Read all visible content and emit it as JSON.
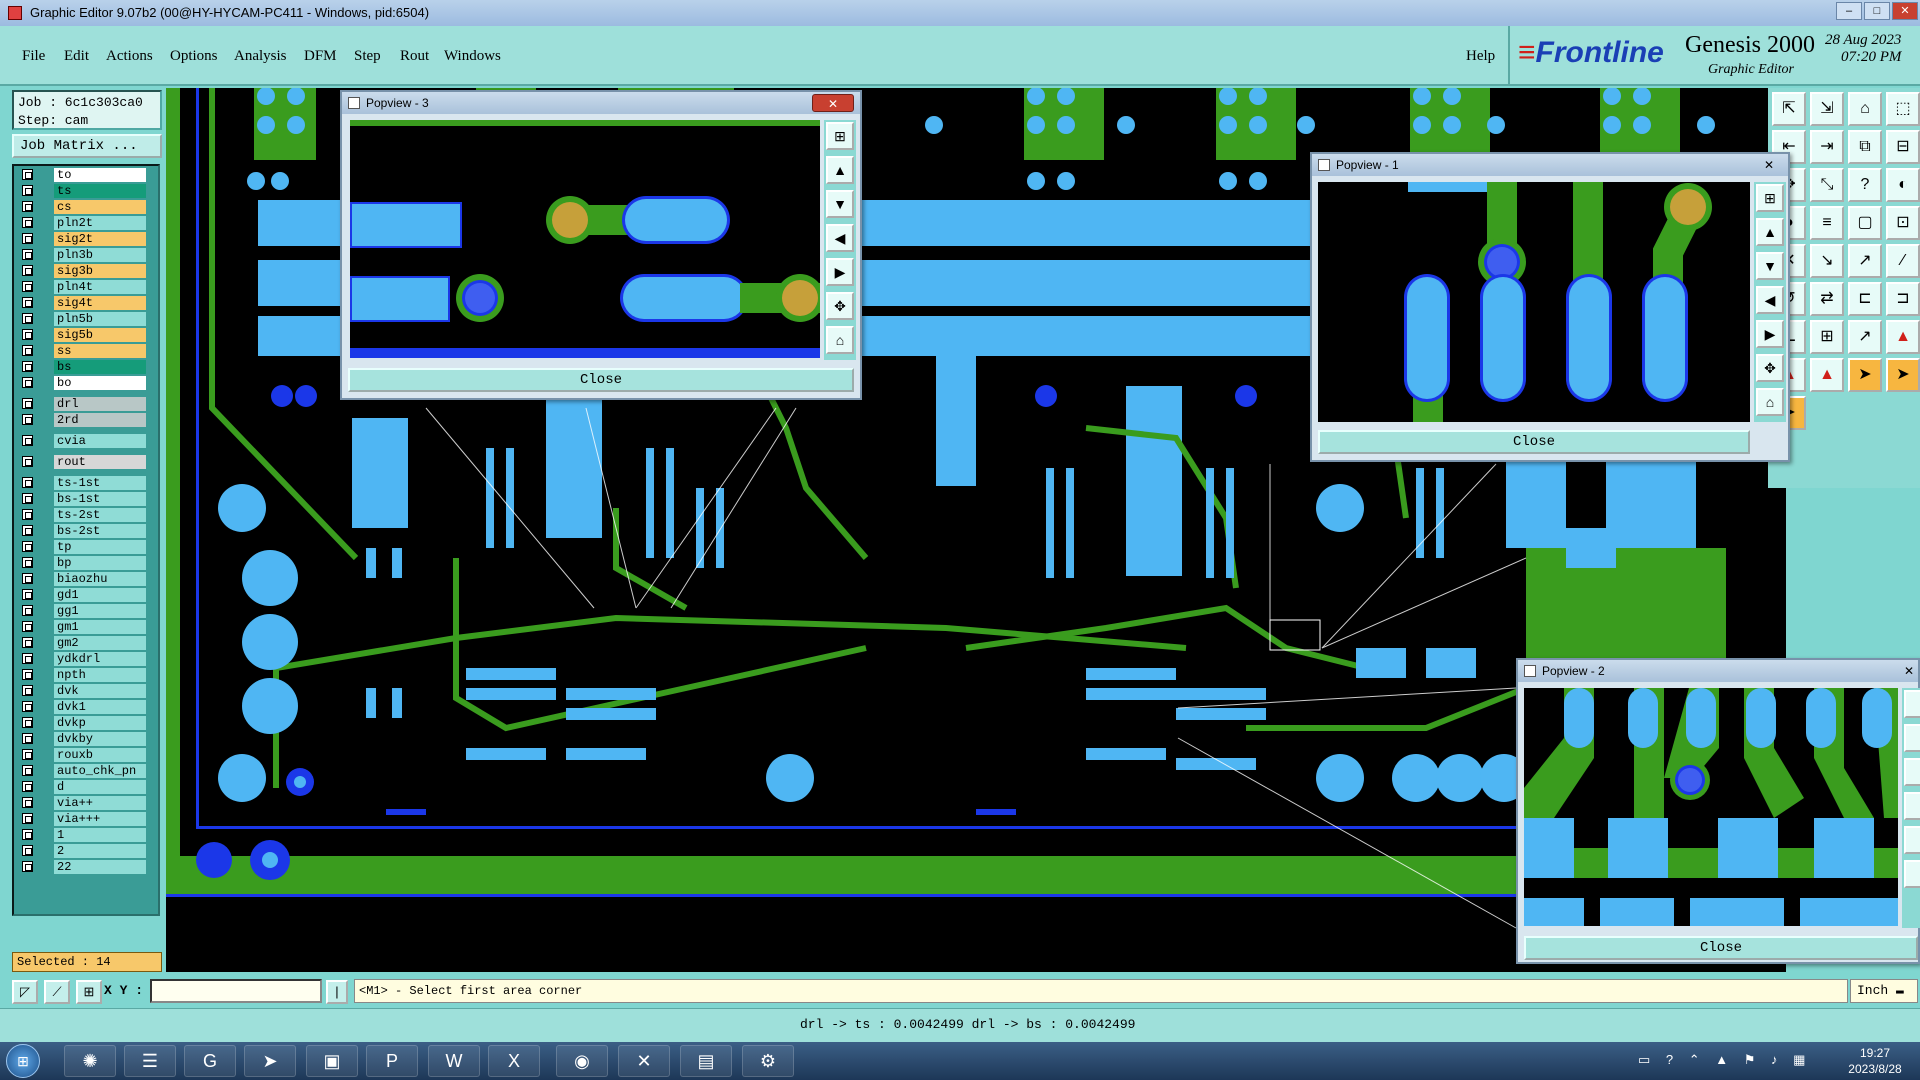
{
  "window": {
    "title": "Graphic Editor 9.07b2 (00@HY-HYCAM-PC411 - Windows, pid:6504)",
    "min": "–",
    "max": "□",
    "close": "✕"
  },
  "menu": {
    "items": [
      "File",
      "Edit",
      "Actions",
      "Options",
      "Analysis",
      "DFM",
      "Step",
      "Rout",
      "Windows"
    ],
    "help": "Help"
  },
  "brand": {
    "logo": "Frontline",
    "product": "Genesis 2000",
    "subtitle": "Graphic Editor",
    "date": "28 Aug 2023",
    "time": "07:20 PM"
  },
  "job": {
    "job_line": "Job : 6c1c303ca0",
    "step_line": "Step: cam",
    "matrix_button": "Job Matrix ..."
  },
  "layers": [
    {
      "name": "to",
      "color": "#ffffff"
    },
    {
      "name": "ts",
      "color": "#159c7a"
    },
    {
      "name": "cs",
      "color": "#f7c86a"
    },
    {
      "name": "pln2t",
      "color": "#8fdcd6"
    },
    {
      "name": "sig2t",
      "color": "#f7c86a"
    },
    {
      "name": "pln3b",
      "color": "#8fdcd6"
    },
    {
      "name": "sig3b",
      "color": "#f7c86a"
    },
    {
      "name": "pln4t",
      "color": "#8fdcd6"
    },
    {
      "name": "sig4t",
      "color": "#f7c86a"
    },
    {
      "name": "pln5b",
      "color": "#8fdcd6"
    },
    {
      "name": "sig5b",
      "color": "#f7c86a"
    },
    {
      "name": "ss",
      "color": "#f7c86a"
    },
    {
      "name": "bs",
      "color": "#159c7a"
    },
    {
      "name": "bo",
      "color": "#ffffff"
    },
    {
      "name": "drl",
      "color": "#b8c7c6"
    },
    {
      "name": "2rd",
      "color": "#b8c7c6"
    },
    {
      "name": "cvia",
      "color": "#8fdcd6"
    },
    {
      "name": "rout",
      "color": "#d7d7d7"
    },
    {
      "name": "ts-1st",
      "color": "#8fdcd6"
    },
    {
      "name": "bs-1st",
      "color": "#8fdcd6"
    },
    {
      "name": "ts-2st",
      "color": "#8fdcd6"
    },
    {
      "name": "bs-2st",
      "color": "#8fdcd6"
    },
    {
      "name": "tp",
      "color": "#8fdcd6"
    },
    {
      "name": "bp",
      "color": "#8fdcd6"
    },
    {
      "name": "biaozhu",
      "color": "#8fdcd6"
    },
    {
      "name": "gd1",
      "color": "#8fdcd6"
    },
    {
      "name": "gg1",
      "color": "#8fdcd6"
    },
    {
      "name": "gm1",
      "color": "#8fdcd6"
    },
    {
      "name": "gm2",
      "color": "#8fdcd6"
    },
    {
      "name": "ydkdrl",
      "color": "#8fdcd6"
    },
    {
      "name": "npth",
      "color": "#8fdcd6"
    },
    {
      "name": "dvk",
      "color": "#8fdcd6"
    },
    {
      "name": "dvk1",
      "color": "#8fdcd6"
    },
    {
      "name": "dvkp",
      "color": "#8fdcd6"
    },
    {
      "name": "dvkby",
      "color": "#8fdcd6"
    },
    {
      "name": "rouxb",
      "color": "#8fdcd6"
    },
    {
      "name": "auto_chk_pn",
      "color": "#8fdcd6"
    },
    {
      "name": "d",
      "color": "#8fdcd6"
    },
    {
      "name": "via++",
      "color": "#8fdcd6"
    },
    {
      "name": "via+++",
      "color": "#8fdcd6"
    },
    {
      "name": "1",
      "color": "#8fdcd6"
    },
    {
      "name": "2",
      "color": "#8fdcd6"
    },
    {
      "name": "22",
      "color": "#8fdcd6"
    }
  ],
  "selected": "Selected : 14",
  "popviews": [
    {
      "title": "Popview - 3",
      "close_label": "Close"
    },
    {
      "title": "Popview - 1",
      "close_label": "Close"
    },
    {
      "title": "Popview - 2",
      "close_label": "Close"
    }
  ],
  "status": {
    "xy_label": "X Y :",
    "xy_value": "",
    "prompt": "<M1> - Select first area corner",
    "unit": "Inch"
  },
  "info": "drl -> ts : 0.0042499   drl -> bs : 0.0042499",
  "taskbar": {
    "time": "19:27",
    "date": "2023/8/28"
  },
  "colors": {
    "copper": "#3a9c1e",
    "pad": "#4fb6f3",
    "via": "#1b37e8",
    "background": "#000000",
    "annular": "#c6a03a"
  }
}
